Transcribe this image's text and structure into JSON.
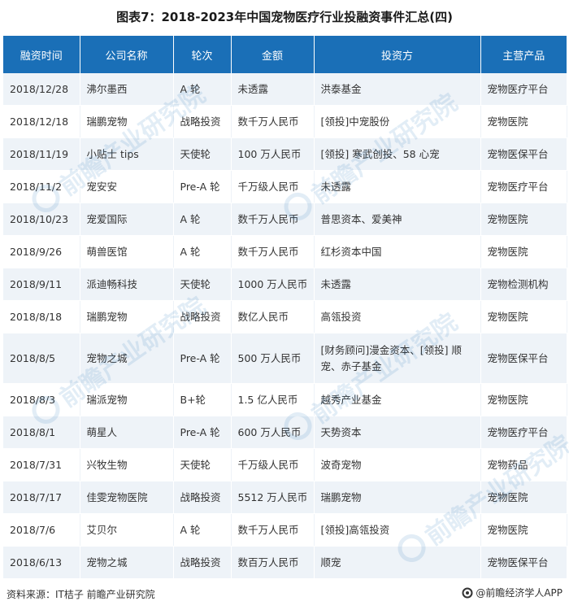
{
  "title": "图表7：2018-2023年中国宠物医疗行业投融资事件汇总(四)",
  "headers": [
    "融资时间",
    "公司名称",
    "轮次",
    "金额",
    "投资方",
    "主营产品"
  ],
  "rows": [
    [
      "2018/12/28",
      "沸尔墨西",
      "A 轮",
      "未透露",
      "洪泰基金",
      "宠物医疗平台"
    ],
    [
      "2018/12/18",
      "瑞鹏宠物",
      "战略投资",
      "数千万人民币",
      "[领投]中宠股份",
      "宠物医院"
    ],
    [
      "2018/11/19",
      "小贴士 tips",
      "天使轮",
      "100 万人民币",
      "[领投] 寒武创投、58 心宠",
      "宠物医保平台"
    ],
    [
      "2018/11/2",
      "宠安安",
      "Pre-A 轮",
      "千万级人民币",
      "未透露",
      "宠物医疗平台"
    ],
    [
      "2018/10/23",
      "宠爱国际",
      "A 轮",
      "数千万人民币",
      "普思资本、爱美神",
      "宠物医院"
    ],
    [
      "2018/9/26",
      "萌兽医馆",
      "A 轮",
      "数千万人民币",
      "红杉资本中国",
      "宠物医院"
    ],
    [
      "2018/9/11",
      "派迪畅科技",
      "天使轮",
      "1000 万人民币",
      "未透露",
      "宠物检测机构"
    ],
    [
      "2018/8/18",
      "瑞鹏宠物",
      "战略投资",
      "数亿人民币",
      "高瓴投资",
      "宠物医院"
    ],
    [
      "2018/8/5",
      "宠物之城",
      "Pre-A 轮",
      "500 万人民币",
      "[财务顾问]漫金资本、[领投] 顺宠、赤子基金",
      "宠物医保平台"
    ],
    [
      "2018/8/3",
      "瑞派宠物",
      "B+轮",
      "1.5 亿人民币",
      "越秀产业基金",
      "宠物医院"
    ],
    [
      "2018/8/1",
      "萌星人",
      "Pre-A 轮",
      "600 万人民币",
      "天势资本",
      "宠物医疗平台"
    ],
    [
      "2018/7/31",
      "兴牧生物",
      "天使轮",
      "千万级人民币",
      "波奇宠物",
      "宠物药品"
    ],
    [
      "2018/7/17",
      "佳雯宠物医院",
      "战略投资",
      "5512 万人民币",
      "瑞鹏宠物",
      "宠物医院"
    ],
    [
      "2018/7/6",
      "艾贝尔",
      "A 轮",
      "数千万人民币",
      "[领投]高瓴投资",
      "宠物医院"
    ],
    [
      "2018/6/13",
      "宠物之城",
      "战略投资",
      "数百万人民币",
      "顺宠",
      "宠物医保平台"
    ]
  ],
  "footer": {
    "source": "资料来源：IT桔子 前瞻产业研究院",
    "brand": "@前瞻经济学人APP",
    "brand_icon": "qianzhan-logo-icon"
  },
  "watermark_text": "前瞻产业研究院",
  "colors": {
    "header_bg": "#1a6fb7",
    "stripe_bg": "#eef3f8"
  }
}
